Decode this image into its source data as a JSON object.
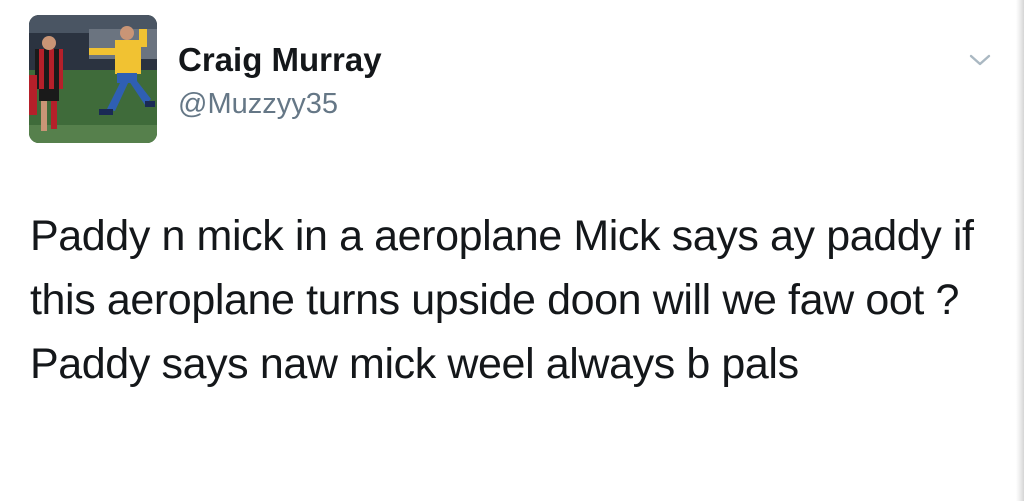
{
  "tweet": {
    "author": {
      "display_name": "Craig Murray",
      "handle": "@Muzzyy35",
      "avatar": "avatar-football-photo"
    },
    "menu_icon": "chevron-down-icon",
    "text": "Paddy n mick in a aeroplane Mick says ay paddy if this aeroplane turns upside doon will we faw oot ? Paddy says naw mick weel always b pals"
  },
  "colors": {
    "text_primary": "#14171a",
    "text_secondary": "#657786",
    "chevron": "#aab8c2",
    "background": "#ffffff"
  }
}
